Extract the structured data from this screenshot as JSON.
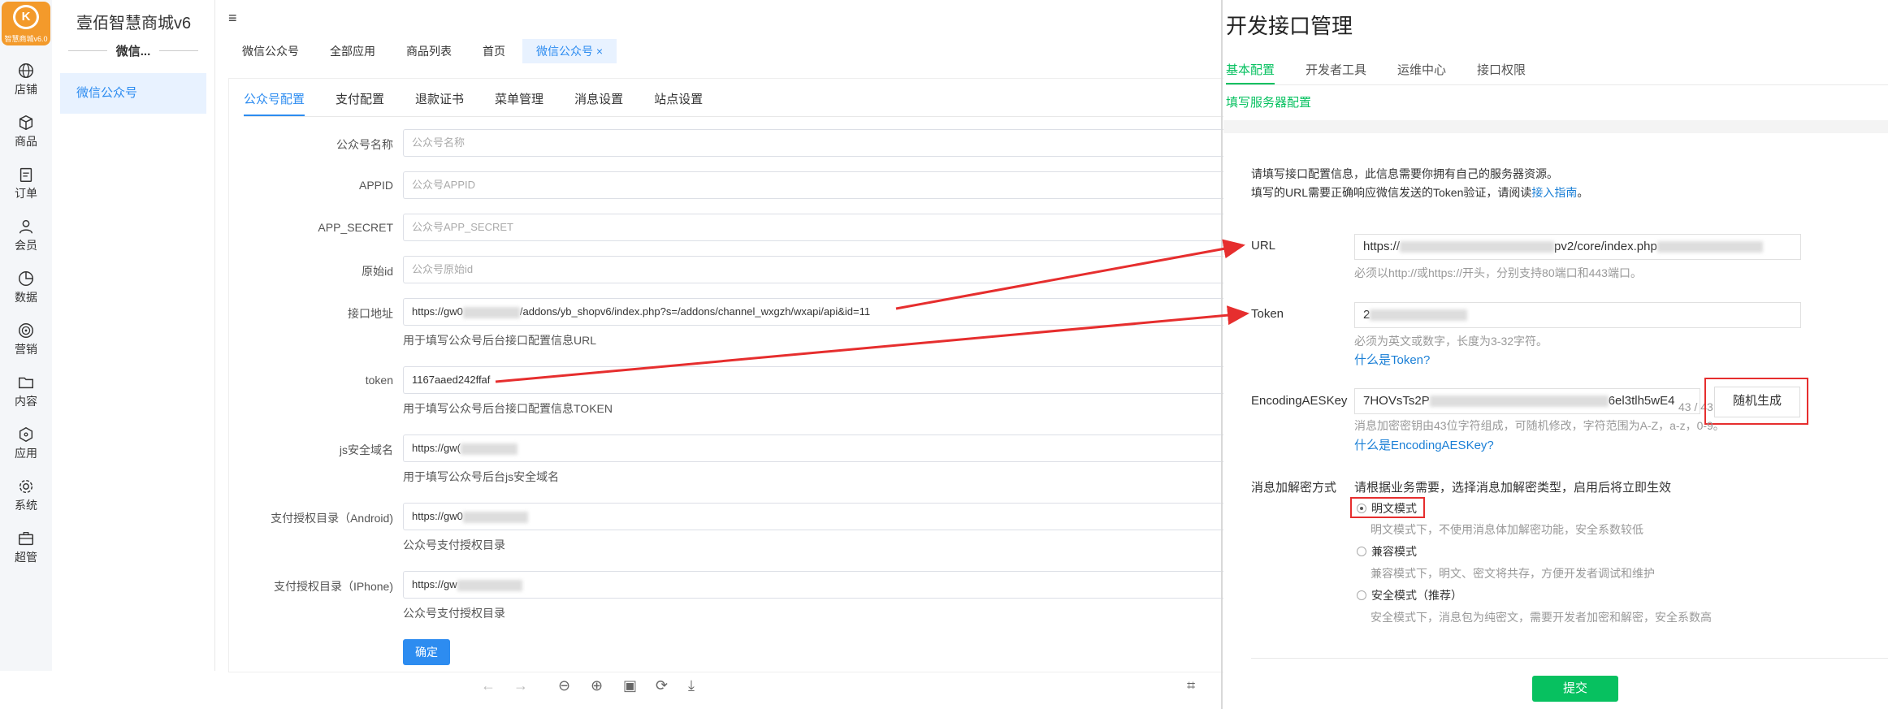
{
  "leftnav": {
    "logo_text": "智慧商城v6.0",
    "items": [
      {
        "label": "店铺",
        "icon": "globe-icon"
      },
      {
        "label": "商品",
        "icon": "box-icon"
      },
      {
        "label": "订单",
        "icon": "clipboard-icon"
      },
      {
        "label": "会员",
        "icon": "user-icon"
      },
      {
        "label": "数据",
        "icon": "pie-chart-icon"
      },
      {
        "label": "营销",
        "icon": "target-icon"
      },
      {
        "label": "内容",
        "icon": "folder-icon"
      },
      {
        "label": "应用",
        "icon": "cube-icon"
      },
      {
        "label": "系统",
        "icon": "gear-icon"
      },
      {
        "label": "超管",
        "icon": "briefcase-icon"
      }
    ]
  },
  "subnav": {
    "brand": "壹佰智慧商城v6",
    "caption": "微信...",
    "item": "微信公众号"
  },
  "tabs": [
    {
      "label": "微信公众号"
    },
    {
      "label": "全部应用"
    },
    {
      "label": "商品列表"
    },
    {
      "label": "首页"
    },
    {
      "label": "微信公众号",
      "active": true,
      "close": "×"
    }
  ],
  "subtabs": [
    "公众号配置",
    "支付配置",
    "退款证书",
    "菜单管理",
    "消息设置",
    "站点设置"
  ],
  "form": {
    "name_label": "公众号名称",
    "name_ph": "公众号名称",
    "appid_label": "APPID",
    "appid_ph": "公众号APPID",
    "secret_label": "APP_SECRET",
    "secret_ph": "公众号APP_SECRET",
    "origin_label": "原始id",
    "origin_ph": "公众号原始id",
    "api_label": "接口地址",
    "api_value_a": "https://gw0",
    "api_value_b": "/addons/yb_shopv6/index.php?s=/addons/channel_wxgzh/wxapi/api&id=11",
    "api_help": "用于填写公众号后台接口配置信息URL",
    "token_label": "token",
    "token_value": "1167aaed242ffaf",
    "token_help": "用于填写公众号后台接口配置信息TOKEN",
    "js_label": "js安全域名",
    "js_value": "https://gw(",
    "js_help": "用于填写公众号后台js安全域名",
    "android_label": "支付授权目录（Android)",
    "android_value": "https://gw0",
    "android_help": "公众号支付授权目录",
    "iphone_label": "支付授权目录（IPhone)",
    "iphone_value": "https://gw",
    "iphone_help": "公众号支付授权目录",
    "ok": "确定"
  },
  "right": {
    "title": "开发接口管理",
    "tabs": [
      "基本配置",
      "开发者工具",
      "运维中心",
      "接口权限"
    ],
    "subtitle": "填写服务器配置",
    "desc1": "请填写接口配置信息，此信息需要你拥有自己的服务器资源。",
    "desc2_a": "填写的URL需要正确响应微信发送的Token验证，请阅读",
    "desc2_link": "接入指南",
    "desc2_b": "。",
    "url_label": "URL",
    "url_value_a": "https://",
    "url_value_b": "pv2/core/index.php",
    "url_help": "必须以http://或https://开头，分别支持80端口和443端口。",
    "token_label": "Token",
    "token_value": "2",
    "token_help": "必须为英文或数字，长度为3-32字符。",
    "token_link": "什么是Token?",
    "aes_label": "EncodingAESKey",
    "aes_value_a": "7HOVsTs2P",
    "aes_value_b": "6el3tlh5wE4",
    "aes_counter": "43 / 43",
    "aes_gen": "随机生成",
    "aes_help": "消息加密密钥由43位字符组成，可随机修改，字符范围为A-Z，a-z，0-9。",
    "aes_link": "什么是EncodingAESKey?",
    "mode_label": "消息加解密方式",
    "mode_desc": "请根据业务需要，选择消息加解密类型，启用后将立即生效",
    "modes": [
      {
        "name": "明文模式",
        "help": "明文模式下，不使用消息体加解密功能，安全系数较低",
        "checked": true
      },
      {
        "name": "兼容模式",
        "help": "兼容模式下，明文、密文将共存，方便开发者调试和维护",
        "checked": false
      },
      {
        "name": "安全模式（推荐）",
        "help": "安全模式下，消息包为纯密文，需要开发者加密和解密，安全系数高",
        "checked": false
      }
    ],
    "submit": "提交"
  },
  "colors": {
    "primary": "#2d8cf0",
    "wechat_green": "#07c160",
    "annotation_red": "#e62e2e",
    "logo_orange": "#f39a2b"
  }
}
